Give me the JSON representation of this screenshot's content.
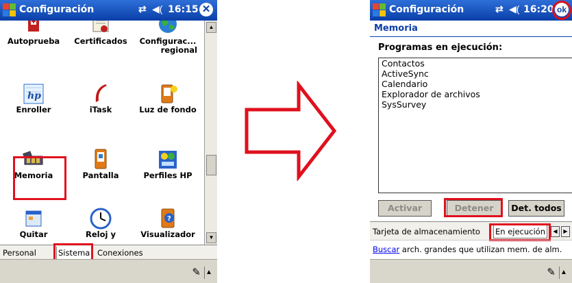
{
  "colors": {
    "titlebar": "#0a3fa8",
    "highlight": "#e0101e",
    "arrow": "#e0101e",
    "section": "#0a3fa8"
  },
  "left": {
    "title": "Configuración",
    "clock": "16:15",
    "close_icon": "close-icon",
    "icons": [
      {
        "label": "Autoprueba",
        "icon": "autoprueba-icon"
      },
      {
        "label": "Certificados",
        "icon": "certificados-icon"
      },
      {
        "label": "Configurac...",
        "label2": "regional",
        "icon": "globe-icon"
      },
      {
        "label": "Enroller",
        "icon": "hp-enroller-icon"
      },
      {
        "label": "iTask",
        "icon": "itask-icon"
      },
      {
        "label": "Luz de fondo",
        "icon": "backlight-icon"
      },
      {
        "label": "Memoria",
        "icon": "memory-chip-icon"
      },
      {
        "label": "Pantalla",
        "icon": "screen-icon"
      },
      {
        "label": "Perfiles HP",
        "icon": "hp-profiles-icon"
      },
      {
        "label": "Quitar",
        "icon": "remove-programs-icon"
      },
      {
        "label": "Reloj y",
        "icon": "clock-icon"
      },
      {
        "label": "Visualizador",
        "icon": "viewer-icon"
      }
    ],
    "tabs": [
      "Personal",
      "Sistema",
      "Conexiones"
    ]
  },
  "right": {
    "title": "Configuración",
    "clock": "16:20",
    "ok_label": "ok",
    "section": "Memoria",
    "programs_label": "Programas en ejecución:",
    "programs": [
      "Contactos",
      "ActiveSync",
      "Calendario",
      "Explorador de archivos",
      "SysSurvey"
    ],
    "buttons": {
      "activate": "Activar",
      "stop": "Detener",
      "stop_all": "Det. todos"
    },
    "tabs": [
      "Tarjeta de almacenamiento",
      "En ejecución"
    ],
    "link": "Buscar",
    "link_rest": " arch. grandes que utilizan mem. de alm."
  }
}
